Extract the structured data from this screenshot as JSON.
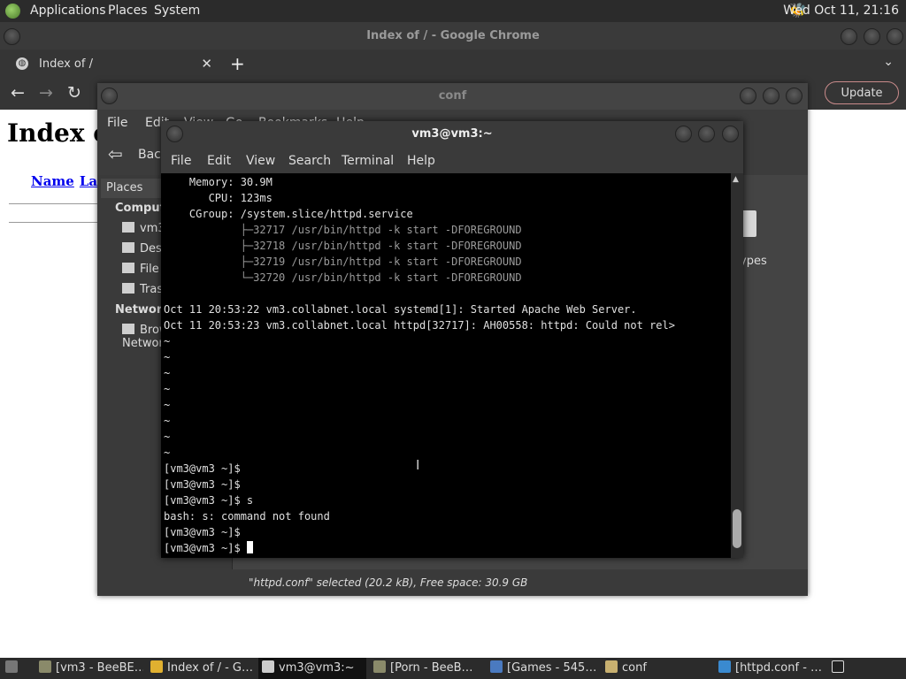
{
  "top_panel": {
    "menus": [
      "Applications",
      "Places",
      "System"
    ],
    "clock": "Wed Oct 11, 21:16"
  },
  "chrome": {
    "window_title": "Index of / - Google Chrome",
    "tab_title": "Index of /",
    "update_label": "Update",
    "page": {
      "heading": "Index o",
      "col_name": "Name",
      "col_last": "Last"
    }
  },
  "nautilus": {
    "window_title": "conf",
    "menus": [
      "File",
      "Edit",
      "View",
      "Go",
      "Bookmarks",
      "Help"
    ],
    "back_label": "Back",
    "places_label": "Places",
    "sidebar": {
      "computer_header": "Computer",
      "computer_items": [
        "vm3",
        "Desktop",
        "File System",
        "Trash"
      ],
      "network_header": "Network",
      "network_items": [
        "Browse Network"
      ]
    },
    "types_label": "ypes",
    "status": "\"httpd.conf\" selected (20.2 kB), Free space: 30.9 GB"
  },
  "terminal": {
    "window_title": "vm3@vm3:~",
    "menus": [
      "File",
      "Edit",
      "View",
      "Search",
      "Terminal",
      "Help"
    ],
    "lines": [
      "    Memory: 30.9M",
      "       CPU: 123ms",
      "    CGroup: /system.slice/httpd.service",
      "            ├─32717 /usr/bin/httpd -k start -DFOREGROUND",
      "            ├─32718 /usr/bin/httpd -k start -DFOREGROUND",
      "            ├─32719 /usr/bin/httpd -k start -DFOREGROUND",
      "            └─32720 /usr/bin/httpd -k start -DFOREGROUND",
      "",
      "Oct 11 20:53:22 vm3.collabnet.local systemd[1]: Started Apache Web Server.",
      "Oct 11 20:53:23 vm3.collabnet.local httpd[32717]: AH00558: httpd: Could not rel>",
      "~",
      "~",
      "~",
      "~",
      "~",
      "~",
      "~",
      "~",
      "[vm3@vm3 ~]$",
      "[vm3@vm3 ~]$",
      "[vm3@vm3 ~]$ s",
      "bash: s: command not found",
      "[vm3@vm3 ~]$",
      "[vm3@vm3 ~]$ "
    ]
  },
  "taskbar": {
    "items": [
      {
        "label": "[vm3 - BeeBE…",
        "icon": "app-icon",
        "color": "#8a8a6a"
      },
      {
        "label": "Index of / - G…",
        "icon": "chrome-icon",
        "color": "#e0b030"
      },
      {
        "label": "vm3@vm3:~",
        "icon": "terminal-icon",
        "color": "#cccccc"
      },
      {
        "label": "[Porn - BeeB…",
        "icon": "app-icon",
        "color": "#8a8a6a"
      },
      {
        "label": "[Games - 545…",
        "icon": "app-icon",
        "color": "#4a7ac0"
      },
      {
        "label": "conf",
        "icon": "folder-icon",
        "color": "#c8b070"
      },
      {
        "label": "[httpd.conf - …",
        "icon": "editor-icon",
        "color": "#3a8ad0"
      }
    ]
  }
}
